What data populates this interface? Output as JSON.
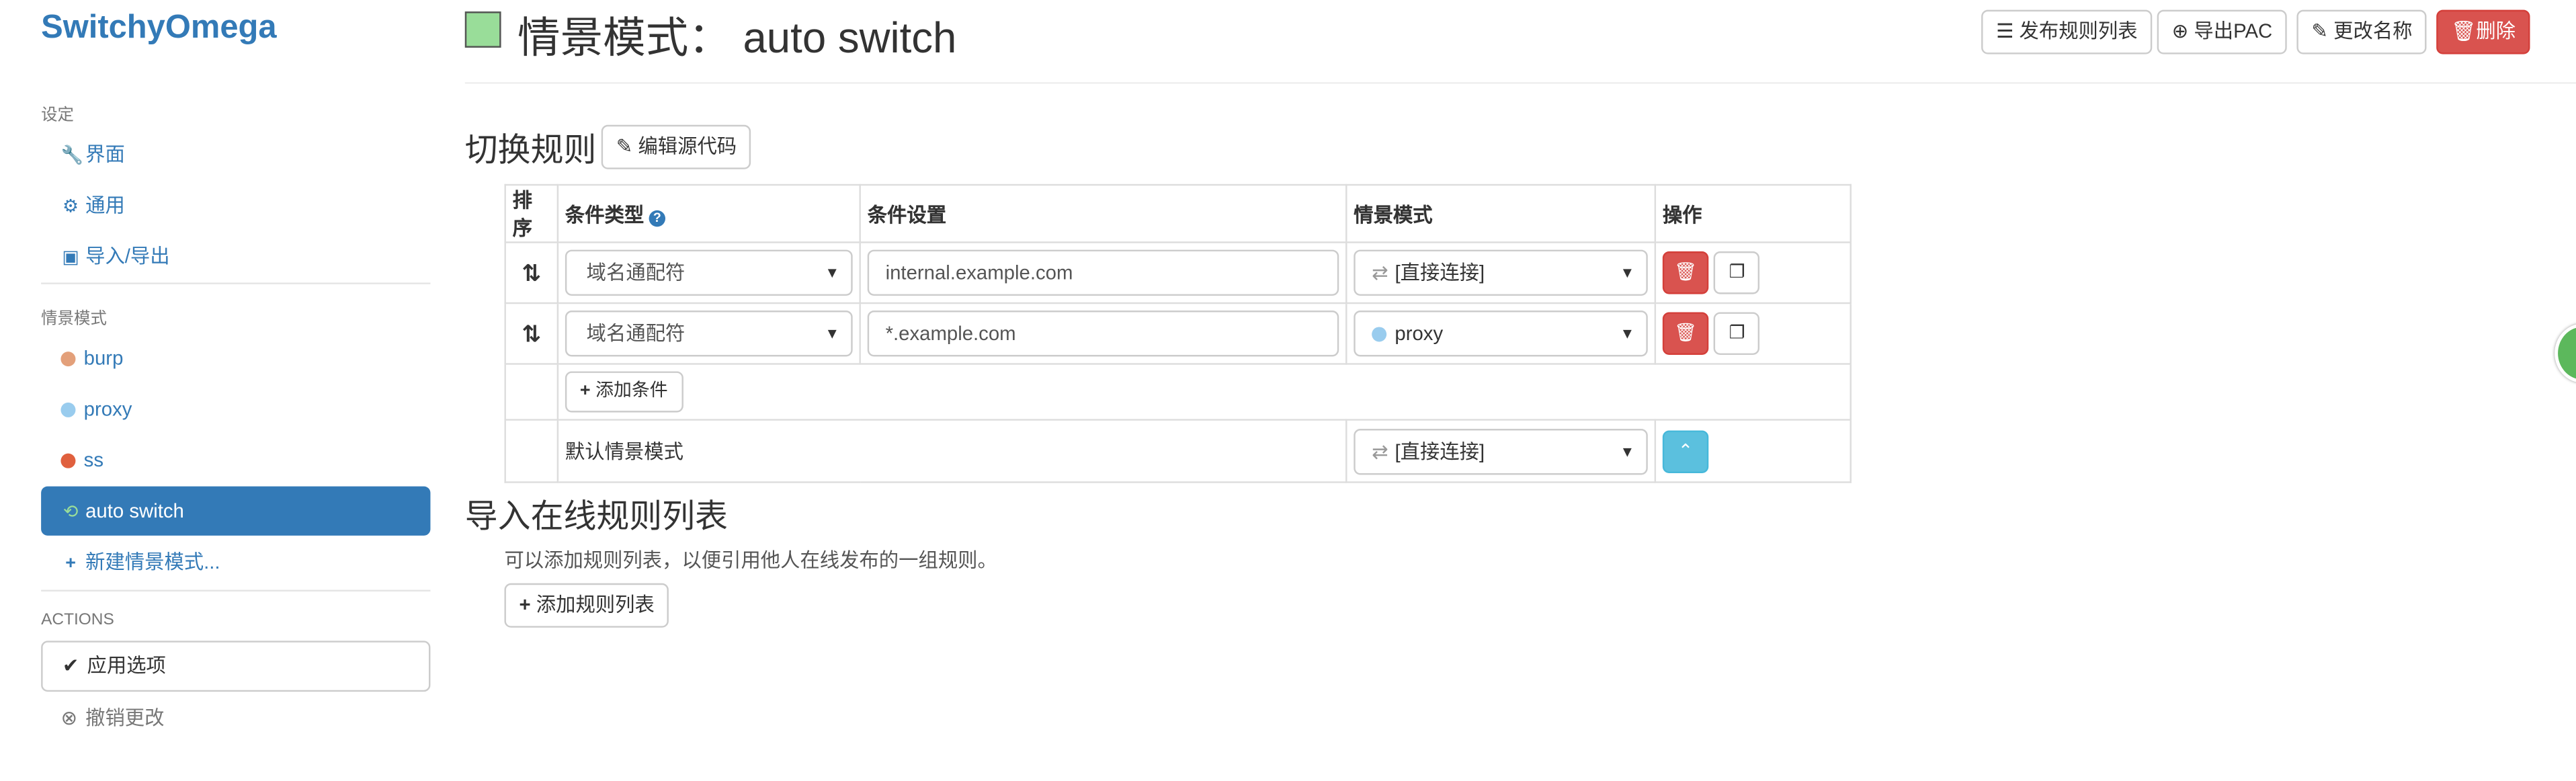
{
  "brand": "SwitchyOmega",
  "sidebar": {
    "settings_header": "设定",
    "settings_items": [
      {
        "label": "界面",
        "icon": "wrench-icon",
        "glyph": "🔧"
      },
      {
        "label": "通用",
        "icon": "gear-icon",
        "glyph": "⚙"
      },
      {
        "label": "导入/导出",
        "icon": "floppy-icon",
        "glyph": "💾"
      }
    ],
    "profiles_header": "情景模式",
    "profiles": [
      {
        "label": "burp",
        "color": "#e3a07a"
      },
      {
        "label": "proxy",
        "color": "#99ccee"
      },
      {
        "label": "ss",
        "color": "#e0603e"
      }
    ],
    "active_profile": {
      "label": "auto switch",
      "glyph": "⟲"
    },
    "new_profile": "新建情景模式...",
    "actions_header": "ACTIONS",
    "apply": "应用选项",
    "discard": "撤销更改"
  },
  "header": {
    "title": "情景模式： auto switch",
    "swatch_color": "#99dd99",
    "publish": "发布规则列表",
    "export_pac": "导出PAC",
    "rename": "更改名称",
    "delete": "删除"
  },
  "rules_section": {
    "title": "切换规则",
    "edit_source": "编辑源代码",
    "columns": {
      "order": "排序",
      "type": "条件类型",
      "setting": "条件设置",
      "profile": "情景模式",
      "ops": "操作"
    },
    "rows": [
      {
        "type": "域名通配符",
        "setting": "internal.example.com",
        "profile": "[直接连接]",
        "profile_icon": "direct-icon"
      },
      {
        "type": "域名通配符",
        "setting": "*.example.com",
        "profile": "proxy",
        "profile_icon": "globe-icon"
      }
    ],
    "add_condition": "添加条件",
    "default_label": "默认情景模式",
    "default_profile": "[直接连接]"
  },
  "online_section": {
    "title": "导入在线规则列表",
    "description": "可以添加规则列表，以便引用他人在线发布的一组规则。",
    "add_button": "添加规则列表"
  }
}
